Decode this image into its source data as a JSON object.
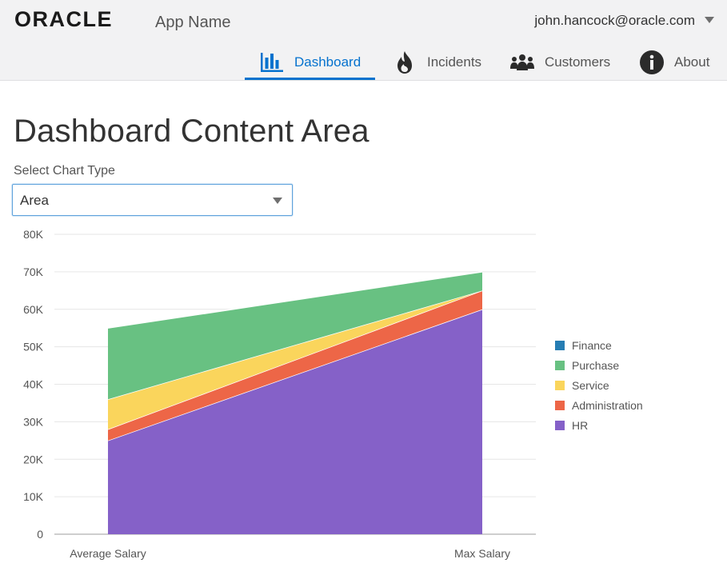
{
  "header": {
    "logo_text": "ORACLE",
    "app_name": "App Name",
    "user_email": "john.hancock@oracle.com"
  },
  "nav": {
    "items": [
      {
        "label": "Dashboard",
        "icon": "chart-bars-icon",
        "active": true
      },
      {
        "label": "Incidents",
        "icon": "fire-icon",
        "active": false
      },
      {
        "label": "Customers",
        "icon": "people-icon",
        "active": false
      },
      {
        "label": "About",
        "icon": "info-icon",
        "active": false
      }
    ]
  },
  "colors": {
    "accent": "#0572ce",
    "Finance": "#267db3",
    "Purchase": "#68c182",
    "Service": "#fad55c",
    "Administration": "#ed6647",
    "HR": "#8561c8"
  },
  "main": {
    "title": "Dashboard Content Area",
    "select_label": "Select Chart Type",
    "select_value": "Area"
  },
  "chart_data": {
    "type": "area",
    "stacked": true,
    "categories": [
      "Average Salary",
      "Max Salary"
    ],
    "yticks": [
      "0",
      "10K",
      "20K",
      "30K",
      "40K",
      "50K",
      "60K",
      "70K",
      "80K"
    ],
    "ylim": [
      0,
      80000
    ],
    "legend_position": "right",
    "series": [
      {
        "name": "Finance",
        "values": [
          0,
          0
        ]
      },
      {
        "name": "Purchase",
        "values": [
          19000,
          5000
        ]
      },
      {
        "name": "Service",
        "values": [
          8000,
          0
        ]
      },
      {
        "name": "Administration",
        "values": [
          3000,
          5000
        ]
      },
      {
        "name": "HR",
        "values": [
          25000,
          60000
        ]
      }
    ]
  }
}
